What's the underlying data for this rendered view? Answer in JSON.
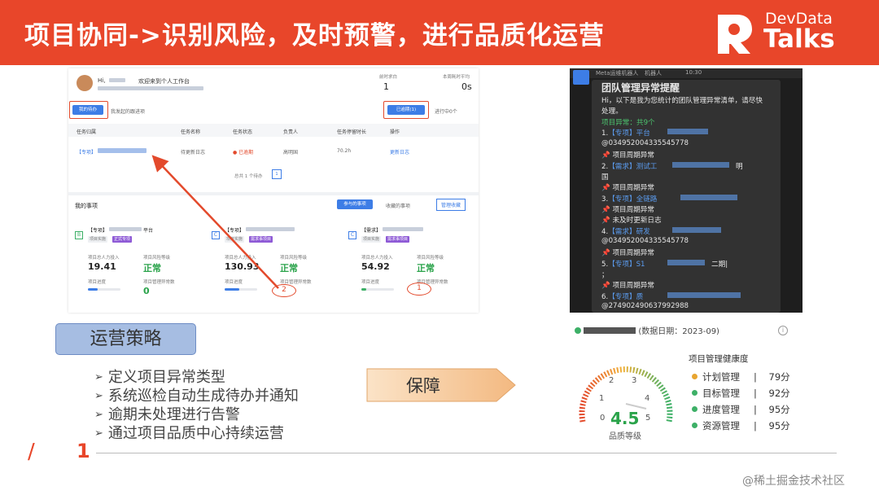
{
  "slide": {
    "title": "项目协同->识别风险，及时预警，进行品质化运营",
    "logo_top": "DevData",
    "logo_bottom": "Talks",
    "page_number": "1",
    "watermark": "@稀土掘金技术社区"
  },
  "dashboard": {
    "greeting": "Hi,",
    "welcome": "欢迎来到个人工作台",
    "stat1_label": "前时求白",
    "stat1_value": "1",
    "stat2_label": "本周耗时平均",
    "stat2_value": "0s",
    "tab_mine": "我的待办",
    "tab_initiated": "我发起的跟进项",
    "overdue_button": "已逾期(1)",
    "in_progress": "进行中0个",
    "columns": [
      "任务归属",
      "任务名称",
      "任务状态",
      "负责人",
      "任务停留时长",
      "操作"
    ],
    "row": {
      "belong": "【专项】",
      "name": "待更新日志",
      "status": "已逾期",
      "owner": "高明国",
      "duration": "70.2h",
      "action": "更新日志"
    },
    "pagination": "总共 1 个待办",
    "page": "1",
    "my_items": "我的事项",
    "btn_joined": "参与的事项",
    "btn_favorites": "收藏的事项",
    "btn_manage": "管理收藏",
    "cards": [
      {
        "grade": "B",
        "tag1": "项目实施",
        "tag2": "正式专项",
        "title": "【专项】",
        "suffix": "平台",
        "label_a": "项目总人力投入",
        "value_a": "19.41",
        "label_b": "项目风险等级",
        "value_b": "正常",
        "label_c": "项目进度",
        "label_d": "项目管理异常数",
        "value_d": "0"
      },
      {
        "grade": "C",
        "tag1": "项目实施",
        "tag2": "需求事项目",
        "title": "【专项】",
        "suffix": "",
        "label_a": "项目总人力投入",
        "value_a": "130.93",
        "label_b": "项目风险等级",
        "value_b": "正常",
        "label_c": "项目进度",
        "label_d": "项目管理异常数",
        "value_d": "2"
      },
      {
        "grade": "C",
        "tag1": "项目实施",
        "tag2": "需求事项目",
        "title": "【需求】",
        "suffix": "",
        "label_a": "项目总人力投入",
        "value_a": "54.92",
        "label_b": "项目风险等级",
        "value_b": "正常",
        "label_c": "项目进度",
        "label_d": "项目管理异常数",
        "value_d": "1"
      }
    ]
  },
  "chat": {
    "bot_name": "Meta运维机器人",
    "bot_tag": "机器人",
    "time": "10:30",
    "header": "团队管理异常提醒",
    "intro1": "Hi，以下是我为您统计的团队管理异常清单，请尽快",
    "intro2": "处理。",
    "summary": "项目异常：共9个",
    "items": [
      {
        "n": "1.",
        "tag": "【专项】",
        "name": "平台",
        "extra": "@034952004335545778",
        "pin": "项目周期异常"
      },
      {
        "n": "2.",
        "tag": "【需求】",
        "name": "测试工",
        "extra": "国",
        "tail": "明",
        "pin": "项目周期异常"
      },
      {
        "n": "3.",
        "tag": "【专项】",
        "name": "全链路",
        "extra": "",
        "pin": "项目周期异常",
        "pin2": "未及时更新日志"
      },
      {
        "n": "4.",
        "tag": "【需求】",
        "name": "研发",
        "extra": "@034952004335545778",
        "pin": "项目周期异常"
      },
      {
        "n": "5.",
        "tag": "【专项】",
        "name": "S1",
        "extra": "；",
        "tail": "二期|",
        "pin": "项目周期异常"
      },
      {
        "n": "6.",
        "tag": "【专项】",
        "name": "质",
        "extra": "@274902490637992988"
      }
    ]
  },
  "health": {
    "data_date": "(数据日期：2023-09)",
    "title": "项目管理健康度",
    "score": "4.5",
    "score_label": "品质等级",
    "gauge_ticks": [
      "0",
      "1",
      "2",
      "3",
      "4",
      "5"
    ],
    "metrics": [
      {
        "name": "计划管理",
        "score": "79分",
        "color": "#e8a530"
      },
      {
        "name": "目标管理",
        "score": "92分",
        "color": "#3db067"
      },
      {
        "name": "进度管理",
        "score": "95分",
        "color": "#3db067"
      },
      {
        "name": "资源管理",
        "score": "95分",
        "color": "#3db067"
      }
    ]
  },
  "strategy": {
    "title": "运营策略",
    "bullets": [
      "定义项目异常类型",
      "系统巡检自动生成待办并通知",
      "逾期未处理进行告警",
      "通过项目品质中心持续运营"
    ],
    "guarantee": "保障"
  }
}
